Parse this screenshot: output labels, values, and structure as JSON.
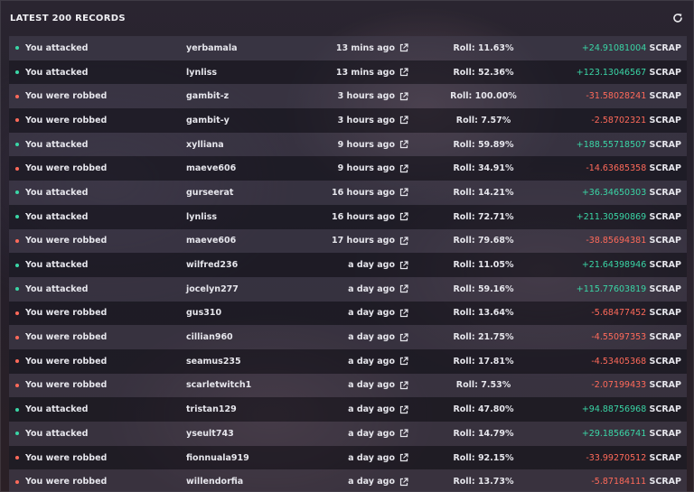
{
  "header": {
    "title": "LATEST 200 RECORDS",
    "refresh_icon": "refresh-icon"
  },
  "colors": {
    "win": "#3ad6a6",
    "loss": "#ff6a5a"
  },
  "roll_label": "Roll:",
  "currency": "SCRAP",
  "records": [
    {
      "type": "You attacked",
      "user": "yerbamala",
      "time": "13 mins ago",
      "roll": "11.63%",
      "amount": "+24.91081004",
      "win": true
    },
    {
      "type": "You attacked",
      "user": "lynliss",
      "time": "13 mins ago",
      "roll": "52.36%",
      "amount": "+123.13046567",
      "win": true
    },
    {
      "type": "You were robbed",
      "user": "gambit-z",
      "time": "3 hours ago",
      "roll": "100.00%",
      "amount": "-31.58028241",
      "win": false
    },
    {
      "type": "You were robbed",
      "user": "gambit-y",
      "time": "3 hours ago",
      "roll": "7.57%",
      "amount": "-2.58702321",
      "win": false
    },
    {
      "type": "You attacked",
      "user": "xylliana",
      "time": "9 hours ago",
      "roll": "59.89%",
      "amount": "+188.55718507",
      "win": true
    },
    {
      "type": "You were robbed",
      "user": "maeve606",
      "time": "9 hours ago",
      "roll": "34.91%",
      "amount": "-14.63685358",
      "win": false
    },
    {
      "type": "You attacked",
      "user": "gurseerat",
      "time": "16 hours ago",
      "roll": "14.21%",
      "amount": "+36.34650303",
      "win": true
    },
    {
      "type": "You attacked",
      "user": "lynliss",
      "time": "16 hours ago",
      "roll": "72.71%",
      "amount": "+211.30590869",
      "win": true
    },
    {
      "type": "You were robbed",
      "user": "maeve606",
      "time": "17 hours ago",
      "roll": "79.68%",
      "amount": "-38.85694381",
      "win": false
    },
    {
      "type": "You attacked",
      "user": "wilfred236",
      "time": "a day ago",
      "roll": "11.05%",
      "amount": "+21.64398946",
      "win": true
    },
    {
      "type": "You attacked",
      "user": "jocelyn277",
      "time": "a day ago",
      "roll": "59.16%",
      "amount": "+115.77603819",
      "win": true
    },
    {
      "type": "You were robbed",
      "user": "gus310",
      "time": "a day ago",
      "roll": "13.64%",
      "amount": "-5.68477452",
      "win": false
    },
    {
      "type": "You were robbed",
      "user": "cillian960",
      "time": "a day ago",
      "roll": "21.75%",
      "amount": "-4.55097353",
      "win": false
    },
    {
      "type": "You were robbed",
      "user": "seamus235",
      "time": "a day ago",
      "roll": "17.81%",
      "amount": "-4.53405368",
      "win": false
    },
    {
      "type": "You were robbed",
      "user": "scarletwitch1",
      "time": "a day ago",
      "roll": "7.53%",
      "amount": "-2.07199433",
      "win": false
    },
    {
      "type": "You attacked",
      "user": "tristan129",
      "time": "a day ago",
      "roll": "47.80%",
      "amount": "+94.88756968",
      "win": true
    },
    {
      "type": "You attacked",
      "user": "yseult743",
      "time": "a day ago",
      "roll": "14.79%",
      "amount": "+29.18566741",
      "win": true
    },
    {
      "type": "You were robbed",
      "user": "fionnuala919",
      "time": "a day ago",
      "roll": "92.15%",
      "amount": "-33.99270512",
      "win": false
    },
    {
      "type": "You were robbed",
      "user": "willendorfia",
      "time": "a day ago",
      "roll": "13.73%",
      "amount": "-5.87184111",
      "win": false
    }
  ]
}
